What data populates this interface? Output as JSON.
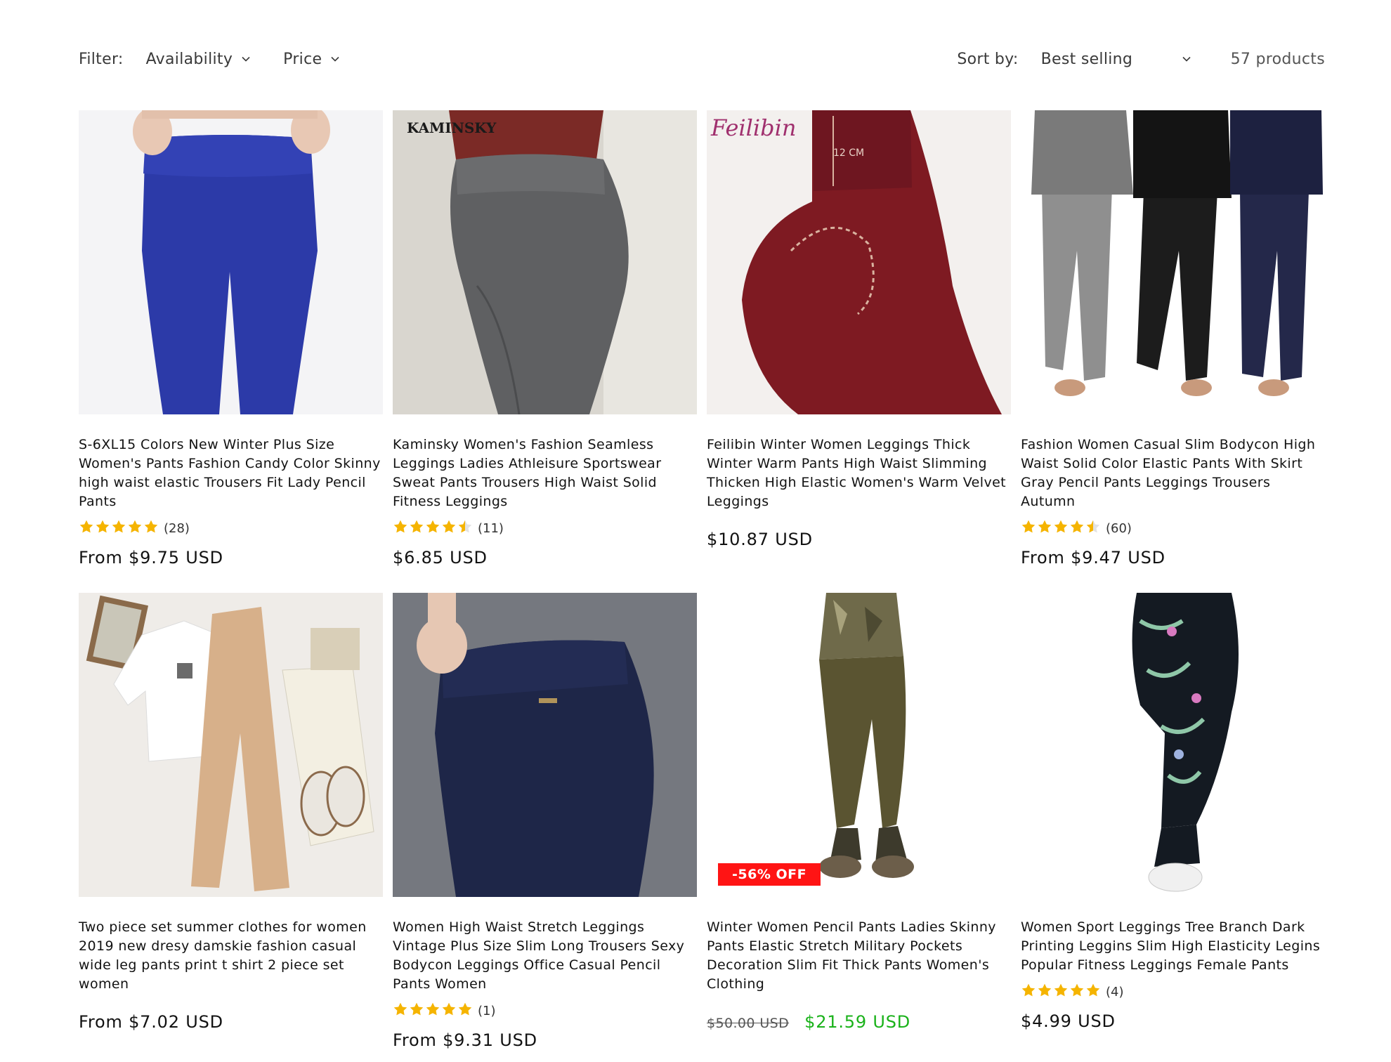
{
  "filter": {
    "label": "Filter:",
    "facets": [
      "Availability",
      "Price"
    ]
  },
  "sort": {
    "label": "Sort by:",
    "value": "Best selling"
  },
  "product_count": "57 products",
  "colors": {
    "sale": "#1ab21a",
    "badge": "#ff1414",
    "star": "#f5b400"
  },
  "products": [
    {
      "title": "S-6XL15 Colors New Winter Plus Size Women's Pants Fashion Candy Color Skinny high waist elastic Trousers Fit Lady Pencil Pants",
      "rating": 5,
      "reviews": "(28)",
      "price": "From $9.75 USD",
      "image": "blue-leggings"
    },
    {
      "title": "Kaminsky Women's Fashion Seamless Leggings Ladies Athleisure Sportswear Sweat Pants Trousers High Waist Solid Fitness Leggings",
      "image_brand": "KAMINSKY",
      "rating": 4.5,
      "reviews": "(11)",
      "price": "$6.85 USD",
      "image": "grey-ribbed-leggings"
    },
    {
      "title": "Feilibin Winter Women Leggings Thick Winter Warm Pants High Waist Slimming Thicken High Elastic Women's Warm Velvet Leggings",
      "image_brand": "Feilibin",
      "image_measure": "12 CM",
      "price": "$10.87 USD",
      "image": "burgundy-leggings"
    },
    {
      "title": "Fashion Women Casual Slim Bodycon High Waist Solid Color Elastic Pants With Skirt Gray Pencil Pants Leggings Trousers Autumn",
      "rating": 4.5,
      "reviews": "(60)",
      "price": "From $9.47 USD",
      "image": "skirted-leggings"
    },
    {
      "title": "Two piece set summer clothes for women 2019 new dresy damskie fashion casual wide leg pants print t shirt 2 piece set women",
      "price": "From $7.02 USD",
      "image": "flatlay-outfit"
    },
    {
      "title": "Women High Waist Stretch Leggings Vintage Plus Size Slim Long Trousers Sexy Bodycon Leggings Office Casual Pencil Pants Women",
      "rating": 5,
      "reviews": "(1)",
      "price": "From $9.31 USD",
      "image": "navy-pants"
    },
    {
      "title": "Winter Women Pencil Pants Ladies Skinny Pants Elastic Stretch Military Pockets Decoration Slim Fit Thick Pants Women's Clothing",
      "badge": "-56% OFF",
      "compare_price": "$50.00 USD",
      "sale_price": "$21.59 USD",
      "image": "camo-pants"
    },
    {
      "title": "Women Sport Leggings Tree Branch Dark Printing Leggins Slim High Elasticity Legins Popular Fitness Leggings Female Pants",
      "rating": 5,
      "reviews": "(4)",
      "price": "$4.99 USD",
      "image": "floral-leggings"
    }
  ]
}
